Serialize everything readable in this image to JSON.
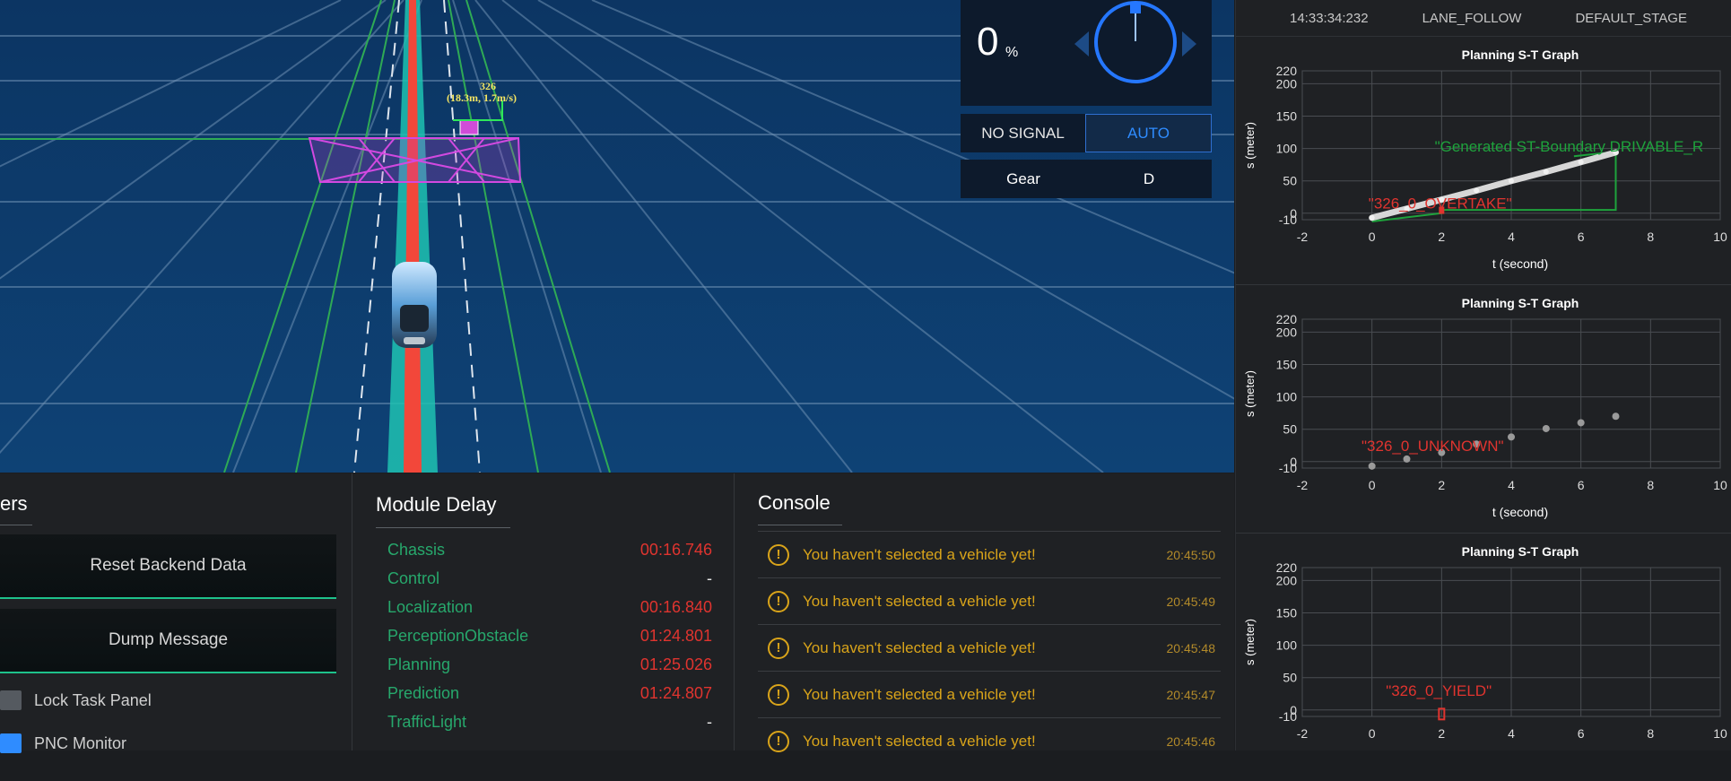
{
  "status": {
    "speed_value": "0",
    "speed_unit": "%",
    "signal_label": "NO SIGNAL",
    "mode_label": "AUTO",
    "gear_label": "Gear",
    "gear_value": "D"
  },
  "scene": {
    "obstacle_id": "326",
    "obstacle_info": "(18.3m, 1.7m/s)"
  },
  "header": {
    "time": "14:33:34:232",
    "scenario": "LANE_FOLLOW",
    "stage": "DEFAULT_STAGE"
  },
  "graphs": [
    {
      "title": "Planning S-T Graph",
      "xlabel": "t (second)",
      "ylabel": "s (meter)",
      "annotation": "\"326_0_OVERTAKE\"",
      "annotation2": "\"Generated ST-Boundary DRIVABLE_R"
    },
    {
      "title": "Planning S-T Graph",
      "xlabel": "t (second)",
      "ylabel": "s (meter)",
      "annotation": "\"326_0_UNKNOWN\""
    },
    {
      "title": "Planning S-T Graph",
      "xlabel": "",
      "ylabel": "s (meter)",
      "annotation": "\"326_0_YIELD\""
    }
  ],
  "axis": {
    "x_ticks": [
      "-2",
      "0",
      "2",
      "4",
      "6",
      "8",
      "10"
    ],
    "y_ticks": [
      "220",
      "200",
      "150",
      "100",
      "50",
      "0",
      "-10"
    ]
  },
  "chart_data": [
    {
      "type": "line",
      "title": "Planning S-T Graph",
      "xlabel": "t (second)",
      "ylabel": "s (meter)",
      "xlim": [
        -2,
        10
      ],
      "ylim": [
        -10,
        220
      ],
      "series": [
        {
          "name": "\"Generated ST-Boundary DRIVABLE_R",
          "x": [
            0,
            1,
            2,
            3,
            4,
            5,
            6,
            7
          ],
          "y": [
            -7,
            7,
            21,
            35,
            50,
            64,
            79,
            94
          ]
        }
      ]
    },
    {
      "type": "scatter",
      "title": "Planning S-T Graph",
      "xlabel": "t (second)",
      "ylabel": "s (meter)",
      "xlim": [
        -2,
        10
      ],
      "ylim": [
        -10,
        220
      ],
      "series": [
        {
          "x": [
            0,
            1,
            2,
            3,
            4,
            5,
            6,
            7
          ],
          "y": [
            -7,
            4,
            14,
            27,
            38,
            51,
            60,
            70
          ]
        }
      ]
    },
    {
      "type": "scatter",
      "title": "Planning S-T Graph",
      "xlabel": "",
      "ylabel": "s (meter)",
      "xlim": [
        -2,
        10
      ],
      "ylim": [
        -10,
        220
      ],
      "series": []
    }
  ],
  "tasks": {
    "title": "ers",
    "reset_label": "Reset Backend Data",
    "dump_label": "Dump Message",
    "lock_label": "Lock Task Panel",
    "pnc_label": "PNC Monitor"
  },
  "delay": {
    "title": "Module Delay",
    "rows": [
      {
        "name": "Chassis",
        "value": "00:16.746"
      },
      {
        "name": "Control",
        "value": "-"
      },
      {
        "name": "Localization",
        "value": "00:16.840"
      },
      {
        "name": "PerceptionObstacle",
        "value": "01:24.801"
      },
      {
        "name": "Planning",
        "value": "01:25.026"
      },
      {
        "name": "Prediction",
        "value": "01:24.807"
      },
      {
        "name": "TrafficLight",
        "value": "-"
      }
    ]
  },
  "console": {
    "title": "Console",
    "rows": [
      {
        "msg": "You haven't selected a vehicle yet!",
        "time": "20:45:50"
      },
      {
        "msg": "You haven't selected a vehicle yet!",
        "time": "20:45:49"
      },
      {
        "msg": "You haven't selected a vehicle yet!",
        "time": "20:45:48"
      },
      {
        "msg": "You haven't selected a vehicle yet!",
        "time": "20:45:47"
      },
      {
        "msg": "You haven't selected a vehicle yet!",
        "time": "20:45:46"
      }
    ]
  },
  "colors": {
    "scene_bg": "#0d3d6e",
    "accent_green": "#1ec28b",
    "delay_name": "#27a86c",
    "delay_value": "#e0342f",
    "warning": "#d9a41a",
    "auto_blue": "#2f8cff"
  }
}
